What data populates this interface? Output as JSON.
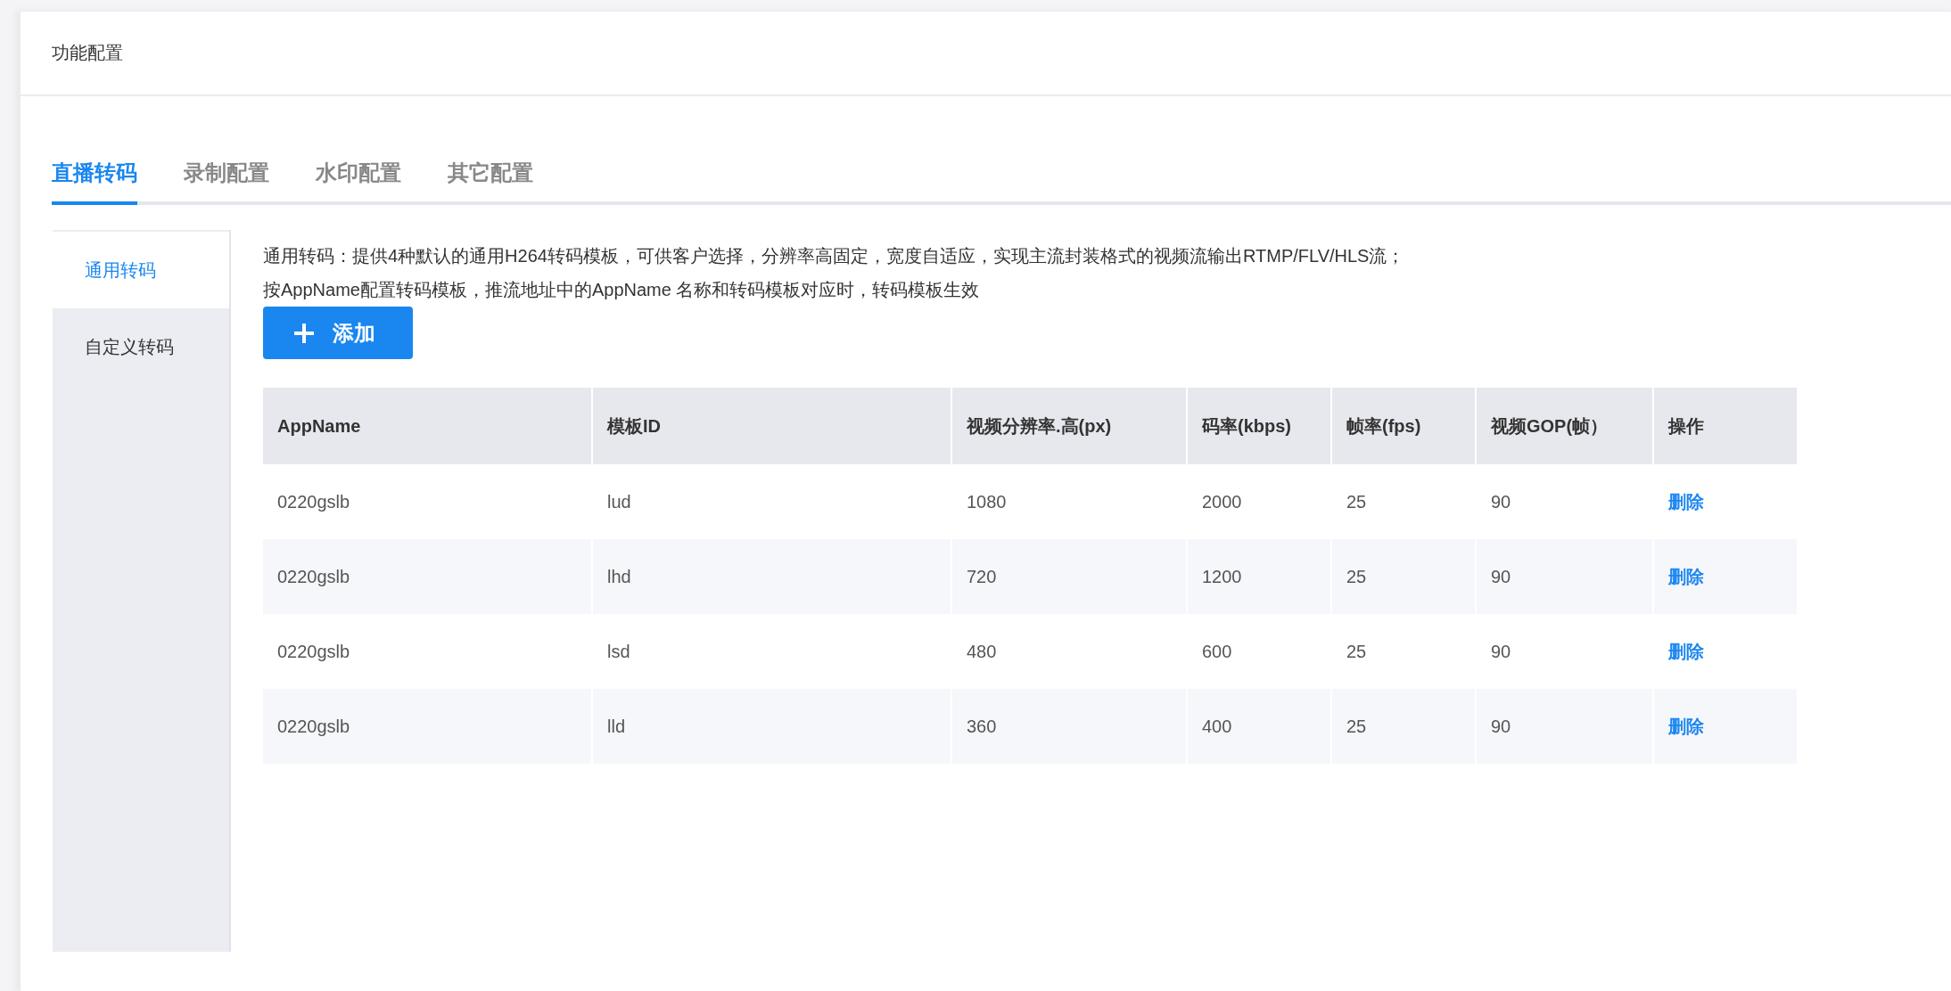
{
  "panel": {
    "title": "功能配置"
  },
  "tabs": [
    {
      "label": "直播转码",
      "selected": true
    },
    {
      "label": "录制配置",
      "selected": false
    },
    {
      "label": "水印配置",
      "selected": false
    },
    {
      "label": "其它配置",
      "selected": false
    }
  ],
  "sidebar": {
    "items": [
      {
        "label": "通用转码",
        "selected": true
      },
      {
        "label": "自定义转码",
        "selected": false
      }
    ]
  },
  "description": [
    "通用转码：提供4种默认的通用H264转码模板，可供客户选择，分辨率高固定，宽度自适应，实现主流封装格式的视频流输出RTMP/FLV/HLS流；",
    "按AppName配置转码模板，推流地址中的AppName 名称和转码模板对应时，转码模板生效"
  ],
  "add_button": {
    "label": "添加"
  },
  "table": {
    "columns": [
      "AppName",
      "模板ID",
      "视频分辨率.高(px)",
      "码率(kbps)",
      "帧率(fps)",
      "视频GOP(帧）",
      "操作"
    ],
    "rows": [
      {
        "cells": [
          "0220gslb",
          "lud",
          "1080",
          "2000",
          "25",
          "90"
        ],
        "action": "删除"
      },
      {
        "cells": [
          "0220gslb",
          "lhd",
          "720",
          "1200",
          "25",
          "90"
        ],
        "action": "删除"
      },
      {
        "cells": [
          "0220gslb",
          "lsd",
          "480",
          "600",
          "25",
          "90"
        ],
        "action": "删除"
      },
      {
        "cells": [
          "0220gslb",
          "lld",
          "360",
          "400",
          "25",
          "90"
        ],
        "action": "删除"
      }
    ]
  }
}
